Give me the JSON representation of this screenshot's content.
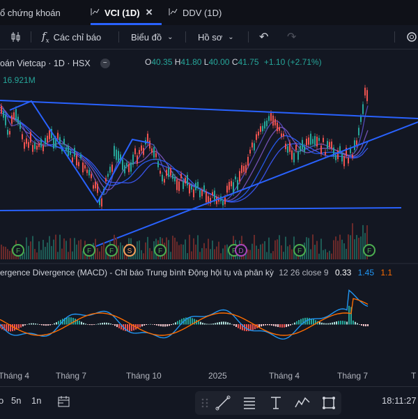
{
  "tabs": [
    {
      "label": "ổ chứng khoán",
      "active": false
    },
    {
      "label": "VCI (1D)",
      "active": true
    },
    {
      "label": "DDV (1D)",
      "active": false
    }
  ],
  "toolbar": {
    "indicators_label": "Các chỉ báo",
    "chart_type_label": "Biểu đồ",
    "profile_label": "Hồ sơ"
  },
  "legend": {
    "symbol": "oán Vietcap · 1D · HSX",
    "open_key": "O",
    "open": "40.35",
    "high_key": "H",
    "high": "41.80",
    "low_key": "L",
    "low": "40.00",
    "close_key": "C",
    "close": "41.75",
    "change": "+1.10 (+2.71%)",
    "volume": "16.921M"
  },
  "macd": {
    "label": "ergence Divergence (MACD) - Chỉ báo Trung bình Động hội tụ và phân kỳ",
    "params": "12 26 close 9",
    "v1": "0.33",
    "v2": "1.45",
    "v3": "1.1"
  },
  "x_axis": [
    "Tháng 4",
    "Tháng 7",
    "Tháng 10",
    "2025",
    "Tháng 4",
    "Tháng 7"
  ],
  "x_axis_right": "T",
  "bottom": {
    "r1": "5n",
    "r2": "1n",
    "r0": "o",
    "time": "18:11:27"
  },
  "event_badges": [
    "F",
    "F",
    "F",
    "S",
    "F",
    "D",
    "F",
    "F"
  ],
  "colors": {
    "up": "#26a69a",
    "down": "#ef5350",
    "trend": "#2962ff",
    "macd": "#2196f3",
    "signal": "#ff6d00"
  }
}
